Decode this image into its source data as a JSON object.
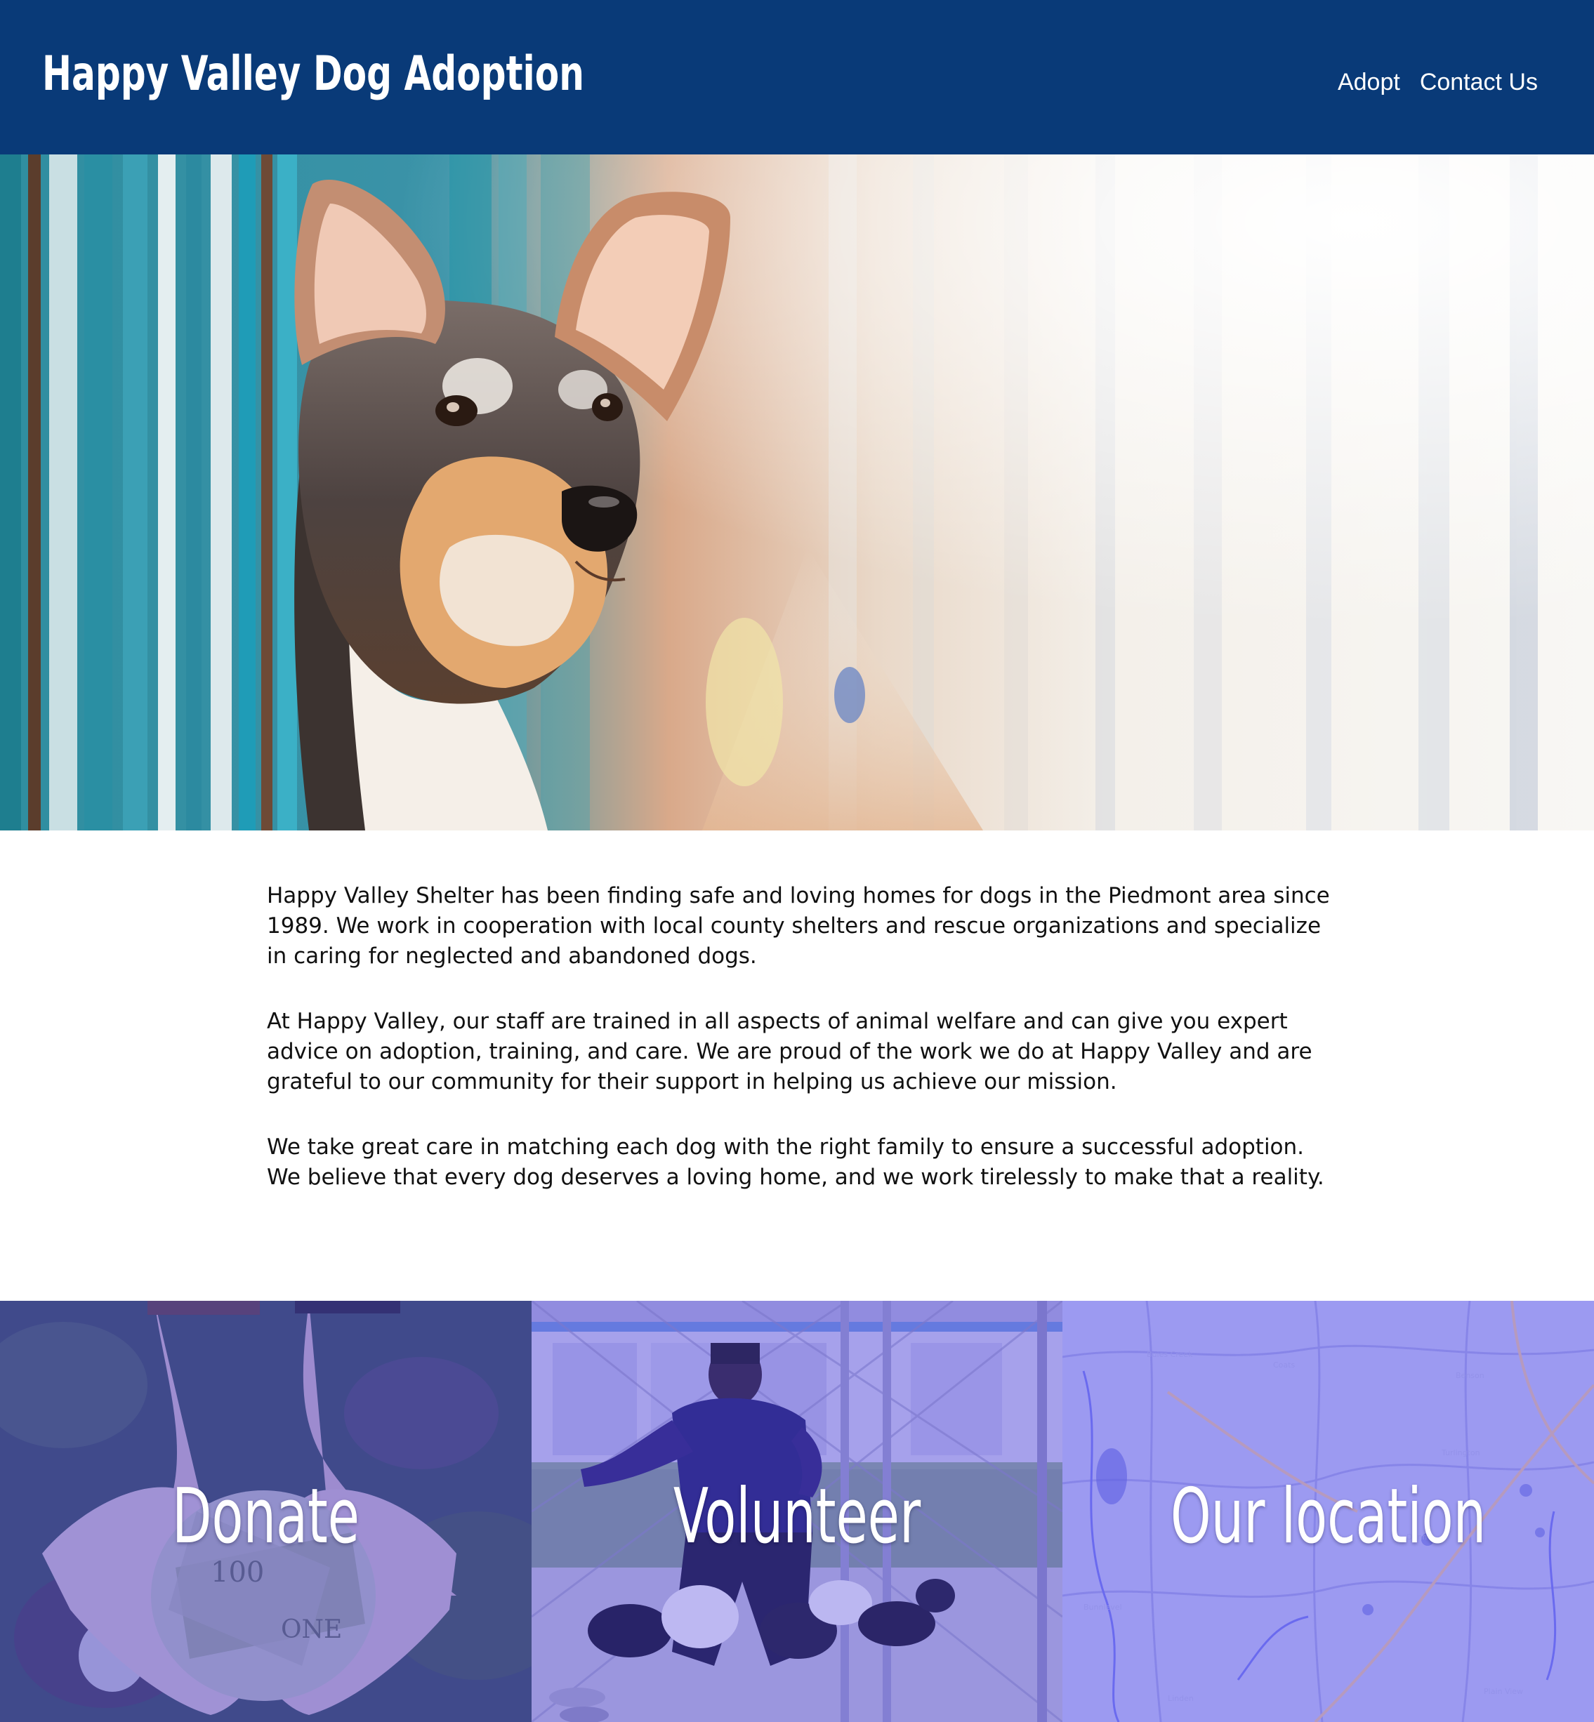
{
  "header": {
    "title": "Happy Valley Dog Adoption",
    "nav": [
      {
        "label": "Adopt"
      },
      {
        "label": "Contact Us"
      }
    ]
  },
  "intro": {
    "paragraphs": [
      "Happy Valley Shelter has been finding safe and loving homes for dogs in the Piedmont area since 1989. We work in cooperation with local county shelters and rescue organizations and specialize in caring for neglected and abandoned dogs.",
      "At Happy Valley, our staff are trained in all aspects of animal welfare and can give you expert advice on adoption, training, and care. We are proud of the work we do at Happy Valley and are grateful to our community for their support in helping us achieve our mission.",
      "We take great care in matching each dog with the right family to ensure a successful adoption. We believe that every dog deserves a loving home, and we work tirelessly to make that a reality."
    ]
  },
  "tiles": [
    {
      "label": "Donate"
    },
    {
      "label": "Volunteer"
    },
    {
      "label": "Our location"
    }
  ],
  "colors": {
    "header_bg": "#093a78",
    "tile_overlay": "#5a5af0",
    "text": "#111111"
  }
}
